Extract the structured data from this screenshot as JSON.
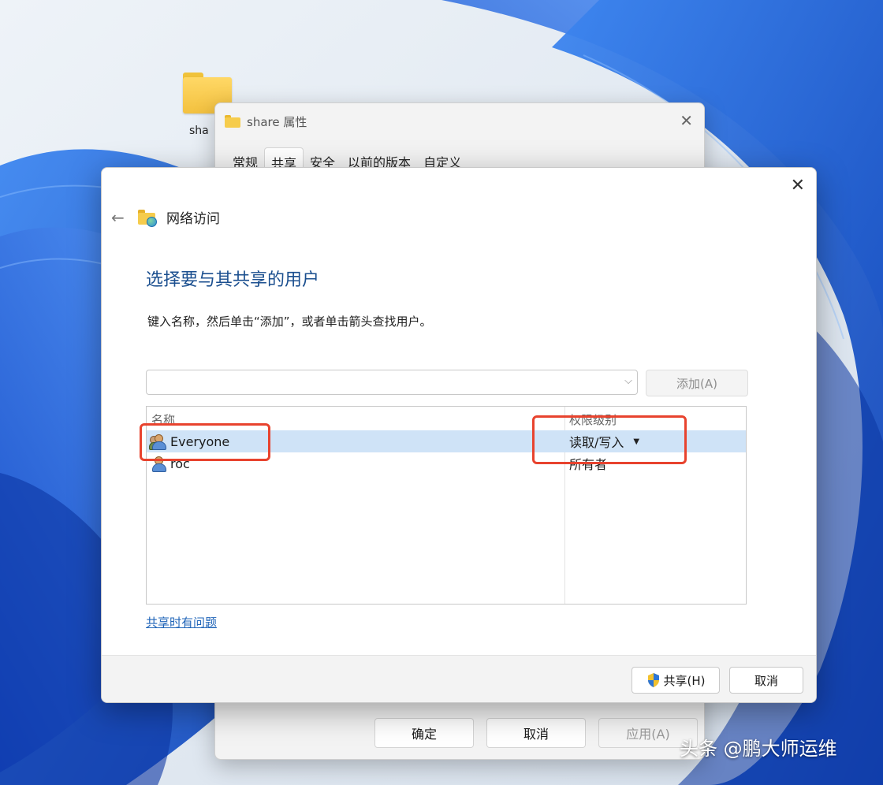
{
  "desktop": {
    "folder_label": "sha"
  },
  "properties_window": {
    "title": "share 属性",
    "tabs": [
      {
        "label": "常规",
        "active": false
      },
      {
        "label": "共享",
        "active": true
      },
      {
        "label": "安全",
        "active": false
      },
      {
        "label": "以前的版本",
        "active": false
      },
      {
        "label": "自定义",
        "active": false
      }
    ],
    "buttons": {
      "ok": "确定",
      "cancel": "取消",
      "apply": "应用(A)"
    }
  },
  "network_access": {
    "title": "网络访问",
    "heading": "选择要与其共享的用户",
    "instruction": "键入名称，然后单击“添加”，或者单击箭头查找用户。",
    "name_input": {
      "value": "",
      "placeholder": ""
    },
    "add_button": "添加(A)",
    "columns": {
      "name": "名称",
      "permission": "权限级别"
    },
    "users": [
      {
        "name": "Everyone",
        "permission": "读取/写入",
        "selected": true,
        "icon": "group-icon",
        "has_dropdown": true
      },
      {
        "name": "roc",
        "permission": "所有者",
        "selected": false,
        "icon": "user-icon",
        "has_dropdown": false
      }
    ],
    "help_link": "共享时有问题",
    "share_button": "共享(H)",
    "cancel_button": "取消"
  },
  "watermark": {
    "text": "头条 @鹏大师运维"
  },
  "colors": {
    "wallpaper_blue": "#1f5fd8",
    "heading_blue": "#1b4f8f",
    "selection": "#cfe3f7",
    "highlight_red": "#e8432e",
    "link_blue": "#1f64b8"
  }
}
